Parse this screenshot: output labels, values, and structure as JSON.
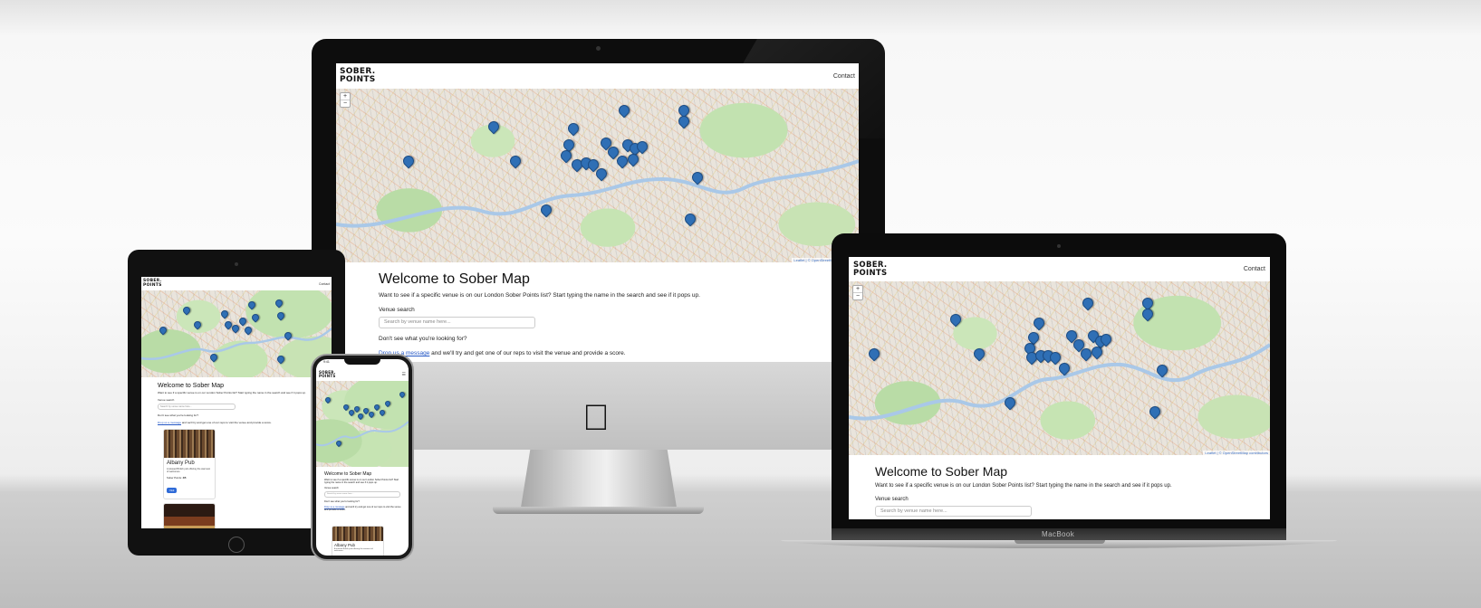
{
  "site": {
    "logo_line1": "SOBER.",
    "logo_line2": "POINTS",
    "nav_contact": "Contact",
    "heading": "Welcome to Sober Map",
    "intro": "Want to see if a specific venue is on our London Sober Points list? Start typing the name in the search and see if it pops up.",
    "search_label": "Venue search",
    "search_placeholder": "Search by venue name here...",
    "missing_question": "Don't see what you're looking for?",
    "drop_link": "Drop us a message",
    "drop_text": " and we'll try and get one of our reps to visit the venue and provide a score.",
    "map_attribution": "Leaflet | © OpenStreetMap contributors",
    "zoom_in": "+",
    "zoom_out": "−"
  },
  "venue_card": {
    "name": "Albany Pub",
    "description": "A relaxed British pub offering the warmest of welcomes.",
    "points_label": "Sober Points: ",
    "points_value": "4/5",
    "button_label": "Visit"
  },
  "phone_status": {
    "time": "9:41"
  },
  "macbook_brand": "MacBook",
  "colors": {
    "pin": "#2f6fb5",
    "link": "#2457c5",
    "river": "#a9c8e8"
  }
}
